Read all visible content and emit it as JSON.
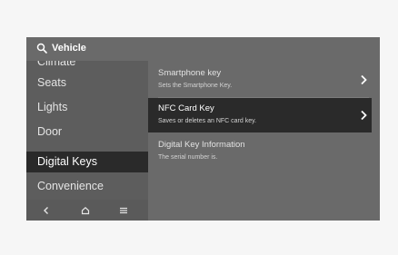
{
  "search": {
    "label": "Vehicle"
  },
  "sidebar": {
    "items": [
      {
        "label": "Climate"
      },
      {
        "label": "Seats"
      },
      {
        "label": "Lights"
      },
      {
        "label": "Door"
      },
      {
        "label": "Digital Keys",
        "active": true
      },
      {
        "label": "Convenience"
      }
    ]
  },
  "bottom_nav": {
    "icons": [
      "back-icon",
      "home-icon",
      "menu-icon"
    ]
  },
  "content": {
    "items": [
      {
        "title": "Smartphone key",
        "subtitle": "Sets the Smartphone Key.",
        "has_chevron": true
      },
      {
        "title": "NFC Card Key",
        "subtitle": "Saves or deletes an NFC card key.",
        "has_chevron": true,
        "active": true
      },
      {
        "title": "Digital Key Information",
        "subtitle": "The serial number is.",
        "has_chevron": false
      }
    ]
  },
  "colors": {
    "screen_bg": "#6a6a6a",
    "sidebar_bg": "#5d5d5d",
    "active_bg": "#2a2a2a",
    "outer_bg": "#f6f6f6"
  }
}
